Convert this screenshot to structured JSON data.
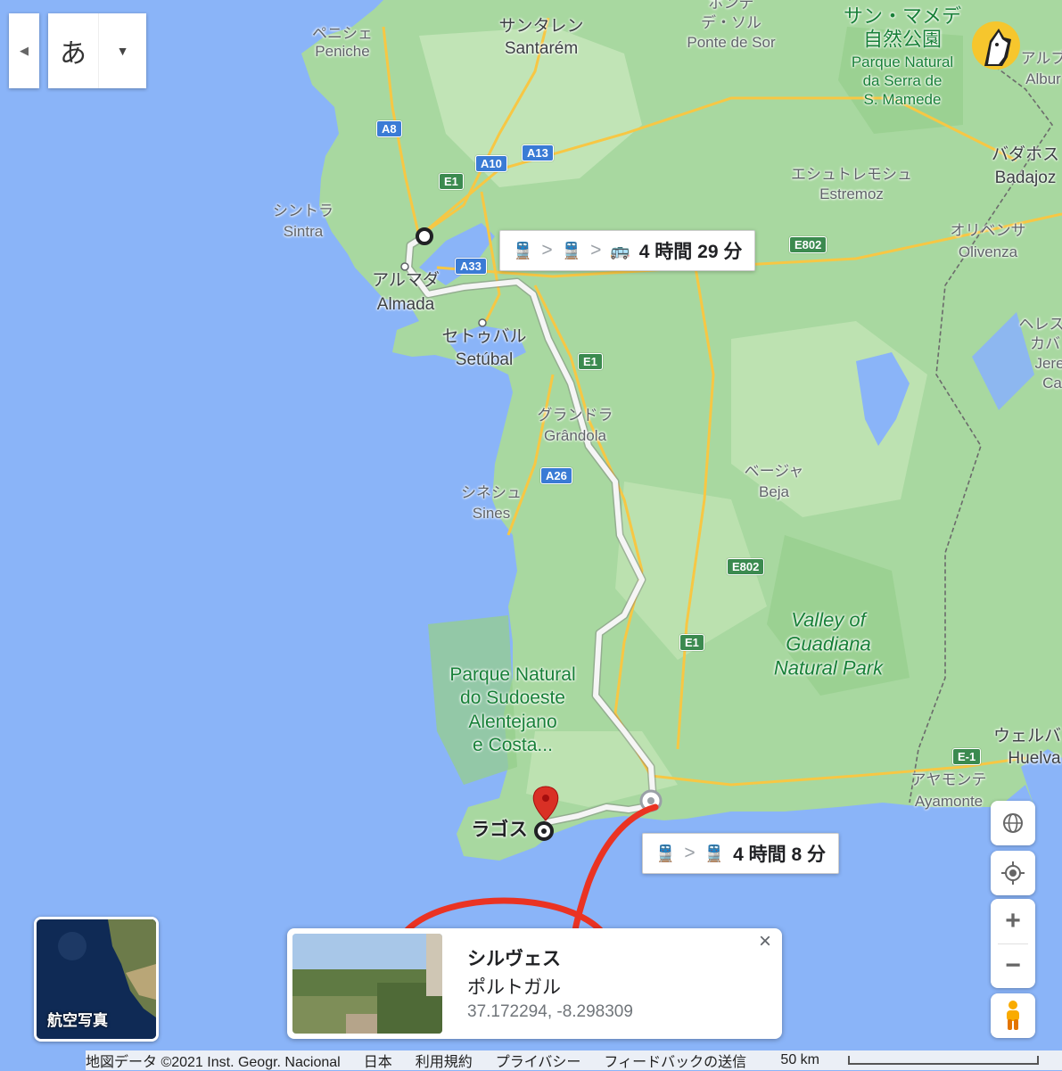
{
  "map": {
    "labels": [
      {
        "id": "peniche-ja",
        "text": "ペニシェ"
      },
      {
        "id": "peniche",
        "text": "Peniche"
      },
      {
        "id": "santarem-ja",
        "text": "サンタレン"
      },
      {
        "id": "santarem",
        "text": "Santarém"
      },
      {
        "id": "pontesor-ja",
        "text": "ポンテ"
      },
      {
        "id": "pontesor-ja2",
        "text": "デ・ソル"
      },
      {
        "id": "pontesor",
        "text": "Ponte de Sor"
      },
      {
        "id": "mamede-ja",
        "text": "サン・マメデ"
      },
      {
        "id": "mamede-ja2",
        "text": "自然公園"
      },
      {
        "id": "mamede1",
        "text": "Parque Natural"
      },
      {
        "id": "mamede2",
        "text": "da Serra de"
      },
      {
        "id": "mamede3",
        "text": "S. Mamede"
      },
      {
        "id": "alb-ja",
        "text": "アルブ"
      },
      {
        "id": "alb",
        "text": "Albur"
      },
      {
        "id": "sintra-ja",
        "text": "シントラ"
      },
      {
        "id": "sintra",
        "text": "Sintra"
      },
      {
        "id": "almada-ja",
        "text": "アルマダ"
      },
      {
        "id": "almada",
        "text": "Almada"
      },
      {
        "id": "setubal-ja",
        "text": "セトゥバル"
      },
      {
        "id": "setubal",
        "text": "Setúbal"
      },
      {
        "id": "estremoz-ja",
        "text": "エシュトレモシュ"
      },
      {
        "id": "estremoz",
        "text": "Estremoz"
      },
      {
        "id": "badajoz-ja",
        "text": "バダホス"
      },
      {
        "id": "badajoz",
        "text": "Badajoz"
      },
      {
        "id": "olivenza-ja",
        "text": "オリベンサ"
      },
      {
        "id": "olivenza",
        "text": "Olivenza"
      },
      {
        "id": "herencas-ja",
        "text": "ヘレス"
      },
      {
        "id": "herencas-ja2",
        "text": "カバ"
      },
      {
        "id": "jere",
        "text": "Jere"
      },
      {
        "id": "ca",
        "text": "Ca"
      },
      {
        "id": "grandola-ja",
        "text": "グランドラ"
      },
      {
        "id": "grandola",
        "text": "Grândola"
      },
      {
        "id": "sines-ja",
        "text": "シネシュ"
      },
      {
        "id": "sines",
        "text": "Sines"
      },
      {
        "id": "beja-ja",
        "text": "ベージャ"
      },
      {
        "id": "beja",
        "text": "Beja"
      },
      {
        "id": "valley1",
        "text": "Valley of"
      },
      {
        "id": "valley2",
        "text": "Guadiana"
      },
      {
        "id": "valley3",
        "text": "Natural Park"
      },
      {
        "id": "sudoeste1",
        "text": "Parque Natural"
      },
      {
        "id": "sudoeste2",
        "text": "do Sudoeste"
      },
      {
        "id": "sudoeste3",
        "text": "Alentejano"
      },
      {
        "id": "sudoeste4",
        "text": "e Costa..."
      },
      {
        "id": "huelva-ja",
        "text": "ウェルバ"
      },
      {
        "id": "huelva",
        "text": "Huelva"
      },
      {
        "id": "ayamonte-ja",
        "text": "アヤモンテ"
      },
      {
        "id": "ayamonte",
        "text": "Ayamonte"
      },
      {
        "id": "lagos-ja",
        "text": "ラゴス"
      }
    ],
    "shields": [
      {
        "id": "a8",
        "text": "A8",
        "color": "blue"
      },
      {
        "id": "a13",
        "text": "A13",
        "color": "blue"
      },
      {
        "id": "a10",
        "text": "A10",
        "color": "blue"
      },
      {
        "id": "e1a",
        "text": "E1",
        "color": "green"
      },
      {
        "id": "a33",
        "text": "A33",
        "color": "blue"
      },
      {
        "id": "e802a",
        "text": "E802",
        "color": "green"
      },
      {
        "id": "e1b",
        "text": "E1",
        "color": "green"
      },
      {
        "id": "a26",
        "text": "A26",
        "color": "blue"
      },
      {
        "id": "e802b",
        "text": "E802",
        "color": "green"
      },
      {
        "id": "e1c",
        "text": "E1",
        "color": "green"
      },
      {
        "id": "e1d",
        "text": "E-1",
        "color": "green"
      }
    ]
  },
  "language_control": {
    "left_arrow": "◀",
    "char": "あ",
    "dropdown": "▼"
  },
  "route_pills": [
    {
      "id": "pill-top",
      "duration": "4 時間 29 分",
      "icons": [
        "train-icon",
        "train-icon",
        "bus-icon"
      ]
    },
    {
      "id": "pill-bottom",
      "duration": "4 時間 8 分",
      "icons": [
        "train-icon",
        "train-icon"
      ]
    }
  ],
  "aerial": {
    "label": "航空写真"
  },
  "place_card": {
    "title": "シルヴェス",
    "subtitle": "ポルトガル",
    "coords": "37.172294, -8.298309",
    "close": "×"
  },
  "controls": {
    "zoom_in": "+",
    "zoom_out": "−"
  },
  "footer": {
    "data": "地図データ ©2021 Inst. Geogr. Nacional",
    "country": "日本",
    "terms": "利用規約",
    "privacy": "プライバシー",
    "feedback": "フィードバックの送信",
    "scale": "50 km"
  },
  "colors": {
    "water": "#8ab4f8",
    "land": "#a8d8a0",
    "route": "#f2f2f2",
    "annotation": "#ea3323",
    "pin": "#d93025"
  }
}
